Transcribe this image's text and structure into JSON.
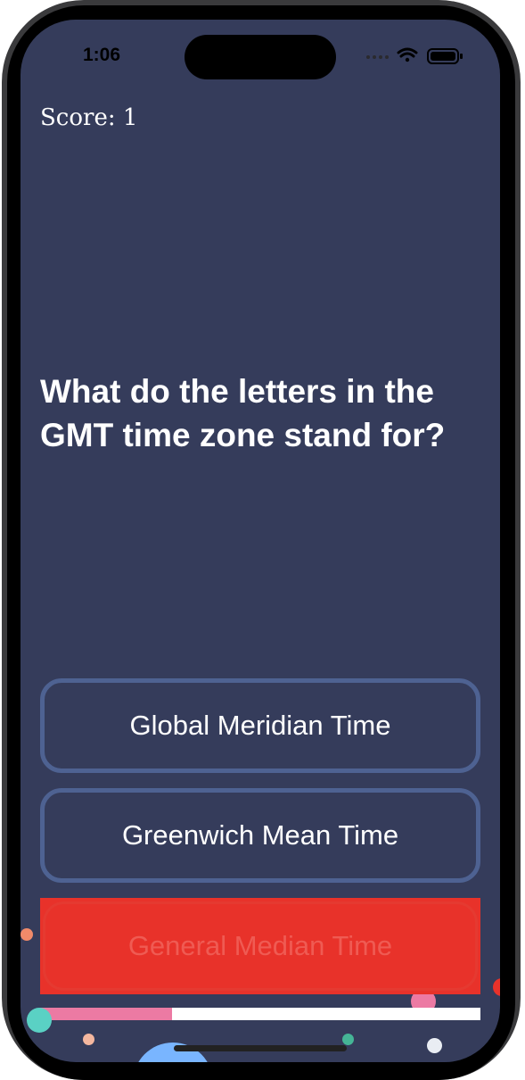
{
  "status_bar": {
    "time": "1:06",
    "signal_icon": "signal-dots-icon",
    "wifi_icon": "wifi-icon",
    "battery_icon": "battery-icon"
  },
  "quiz": {
    "score_text": "Score: 1",
    "question": "What do the letters in the GMT time zone stand for?",
    "answers": [
      {
        "label": "Global Meridian Time",
        "state": "default"
      },
      {
        "label": "Greenwich Mean Time",
        "state": "default"
      },
      {
        "label": "General Median Time",
        "state": "wrong"
      }
    ],
    "progress": 0.3
  },
  "colors": {
    "background": "#353c5b",
    "answer_border": "#4e6292",
    "wrong_answer": "#e8322a",
    "progress_fill": "#ec7aa3",
    "progress_track": "#ffffff"
  }
}
